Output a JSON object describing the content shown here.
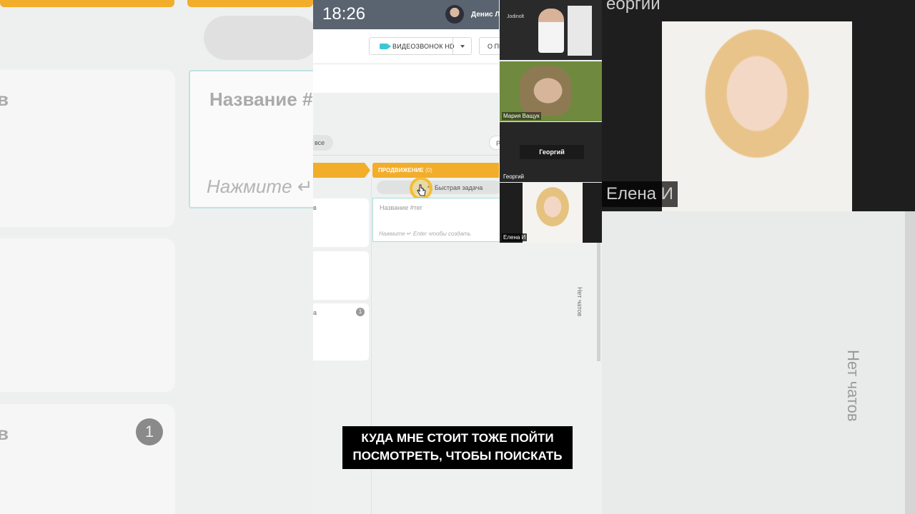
{
  "status_bar": {
    "time": "18:26",
    "user_name": "Денис Ло"
  },
  "toolbar": {
    "video_call_label": "ВИДЕОЗВОНОК HD",
    "about_label": "О ПР"
  },
  "filters": {
    "all_label": "все",
    "right_pill_label": "Р"
  },
  "board": {
    "column": {
      "title": "ПРОДВИЖЕНИЕ",
      "count": "(0)"
    },
    "quick_task_label": "Быстрая задача",
    "new_task": {
      "name_placeholder": "Название #тег",
      "hint": "Нажмите ↵ Enter чтобы создать"
    },
    "left_cards": [
      {
        "fragment": "в",
        "badge": ""
      },
      {
        "fragment": "",
        "badge": ""
      },
      {
        "fragment": "а",
        "badge": "1"
      }
    ]
  },
  "chat_panel": {
    "empty_label": "Нет чатов"
  },
  "participants": [
    {
      "name": "",
      "logo": "Jodinolt"
    },
    {
      "name": "Мария Ващук"
    },
    {
      "name": "Георгий",
      "label": "Георгий"
    },
    {
      "name": "Елена И"
    }
  ],
  "background": {
    "left_title": "Название #",
    "left_hint": "Нажмите ↵",
    "left_letter_1": "в",
    "left_letter_2": "в",
    "left_badge": "1",
    "right_top_label": "еоргий",
    "right_name": "Елена И",
    "right_vertical": "Нет чатов"
  },
  "subtitle": {
    "line1": "КУДА МНЕ СТОИТ ТОЖЕ ПОЙТИ",
    "line2": "ПОСМОТРЕТЬ, ЧТОБЫ ПОИСКАТЬ"
  },
  "colors": {
    "accent": "#f2ad2b",
    "video_icon": "#3ec7d3",
    "card_border": "#a7dcdc"
  }
}
